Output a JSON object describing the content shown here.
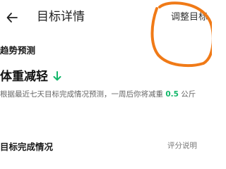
{
  "appbar": {
    "back_icon": "arrow-left-icon",
    "title": "目标详情",
    "adjust_label": "调整目标"
  },
  "trend_section": {
    "label": "趋势预测",
    "title": "体重减轻",
    "title_icon": "arrow-down-icon",
    "desc_prefix": "根据最近七天目标完成情况预测，一周后你将减重",
    "desc_value": "0.5",
    "desc_suffix": "公斤"
  },
  "completion_section": {
    "label": "目标完成情况",
    "rule_link": "评分说明"
  },
  "colors": {
    "accent_green": "#12b76a",
    "annotation_orange": "#f07a17"
  }
}
